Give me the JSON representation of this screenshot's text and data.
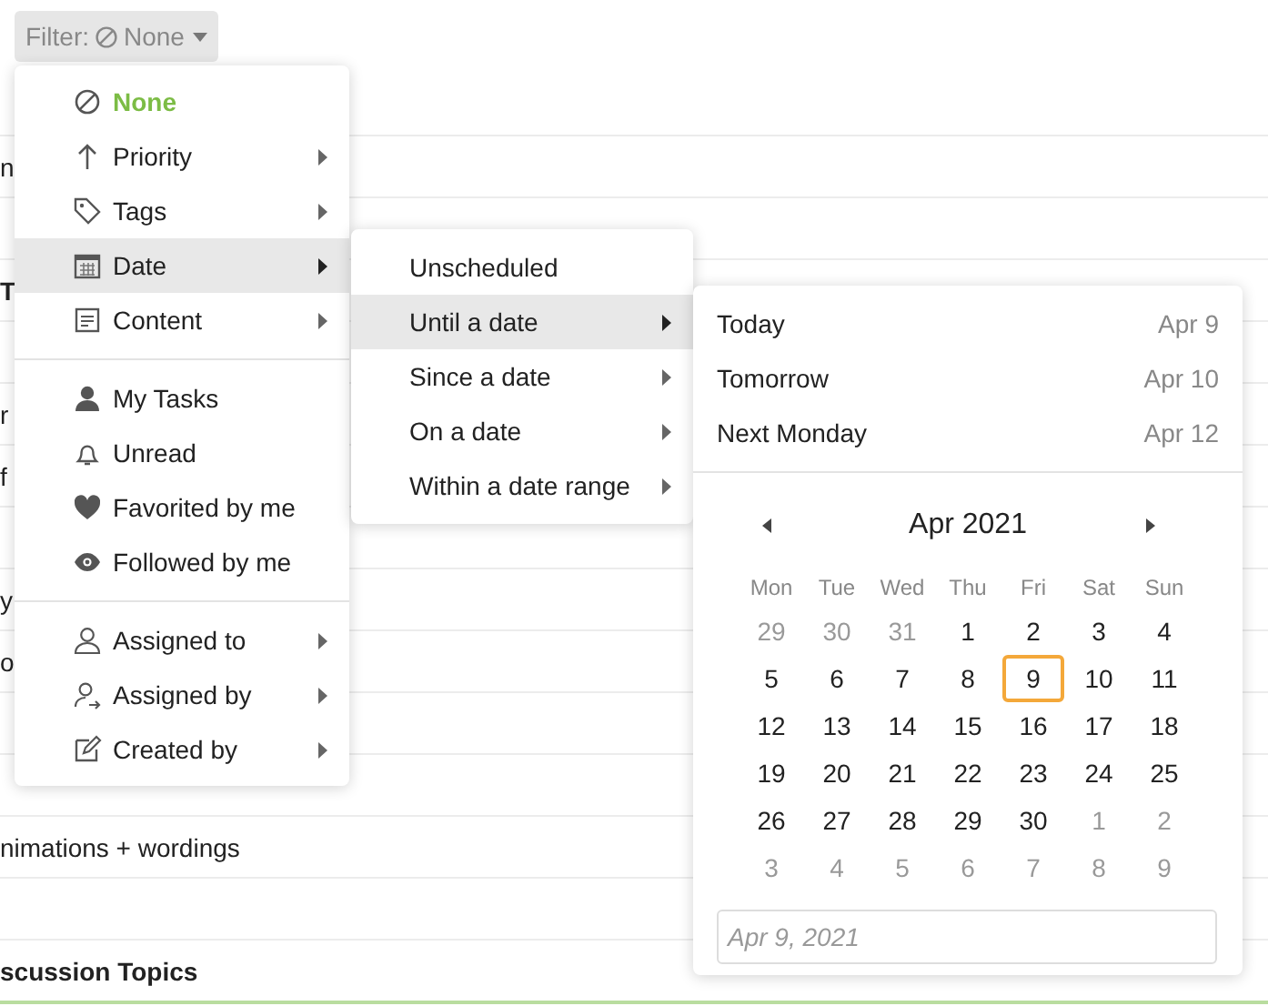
{
  "filter_button": {
    "label": "Filter:",
    "value": "None"
  },
  "background_rows": [
    {
      "kind": "blank"
    },
    {
      "kind": "text",
      "text": "n",
      "bold": false
    },
    {
      "kind": "blank"
    },
    {
      "kind": "text",
      "text": "T",
      "bold": true
    },
    {
      "kind": "blank"
    },
    {
      "kind": "text",
      "text": "r",
      "bold": false
    },
    {
      "kind": "text",
      "text": "f",
      "bold": false
    },
    {
      "kind": "blank"
    },
    {
      "kind": "text",
      "text": "y",
      "bold": false
    },
    {
      "kind": "text",
      "text": "o",
      "bold": false
    },
    {
      "kind": "blank"
    },
    {
      "kind": "blank"
    },
    {
      "kind": "text",
      "text": "nimations + wordings",
      "bold": false
    },
    {
      "kind": "blank"
    },
    {
      "kind": "text",
      "text": "scussion Topics",
      "bold": true
    }
  ],
  "filter_menu": {
    "groups": [
      [
        {
          "label": "None",
          "active": true,
          "submenu": false,
          "selected": false
        },
        {
          "label": "Priority",
          "active": false,
          "submenu": true,
          "selected": false
        },
        {
          "label": "Tags",
          "active": false,
          "submenu": true,
          "selected": false
        },
        {
          "label": "Date",
          "active": false,
          "submenu": true,
          "selected": true
        },
        {
          "label": "Content",
          "active": false,
          "submenu": true,
          "selected": false
        }
      ],
      [
        {
          "label": "My Tasks",
          "active": false,
          "submenu": false,
          "selected": false
        },
        {
          "label": "Unread",
          "active": false,
          "submenu": false,
          "selected": false
        },
        {
          "label": "Favorited by me",
          "active": false,
          "submenu": false,
          "selected": false
        },
        {
          "label": "Followed by me",
          "active": false,
          "submenu": false,
          "selected": false
        }
      ],
      [
        {
          "label": "Assigned to",
          "active": false,
          "submenu": true,
          "selected": false
        },
        {
          "label": "Assigned by",
          "active": false,
          "submenu": true,
          "selected": false
        },
        {
          "label": "Created by",
          "active": false,
          "submenu": true,
          "selected": false
        }
      ]
    ]
  },
  "date_menu": {
    "items": [
      {
        "label": "Unscheduled",
        "submenu": false,
        "selected": false
      },
      {
        "label": "Until a date",
        "submenu": true,
        "selected": true
      },
      {
        "label": "Since a date",
        "submenu": true,
        "selected": false
      },
      {
        "label": "On a date",
        "submenu": true,
        "selected": false
      },
      {
        "label": "Within a date range",
        "submenu": true,
        "selected": false
      }
    ]
  },
  "date_picker": {
    "shortcuts": [
      {
        "label": "Today",
        "date": "Apr 9"
      },
      {
        "label": "Tomorrow",
        "date": "Apr 10"
      },
      {
        "label": "Next Monday",
        "date": "Apr 12"
      }
    ],
    "month": "Apr 2021",
    "weekdays": [
      "Mon",
      "Tue",
      "Wed",
      "Thu",
      "Fri",
      "Sat",
      "Sun"
    ],
    "weeks": [
      [
        {
          "d": "29",
          "muted": true,
          "today": false
        },
        {
          "d": "30",
          "muted": true,
          "today": false
        },
        {
          "d": "31",
          "muted": true,
          "today": false
        },
        {
          "d": "1",
          "muted": false,
          "today": false
        },
        {
          "d": "2",
          "muted": false,
          "today": false
        },
        {
          "d": "3",
          "muted": false,
          "today": false
        },
        {
          "d": "4",
          "muted": false,
          "today": false
        }
      ],
      [
        {
          "d": "5",
          "muted": false,
          "today": false
        },
        {
          "d": "6",
          "muted": false,
          "today": false
        },
        {
          "d": "7",
          "muted": false,
          "today": false
        },
        {
          "d": "8",
          "muted": false,
          "today": false
        },
        {
          "d": "9",
          "muted": false,
          "today": true
        },
        {
          "d": "10",
          "muted": false,
          "today": false
        },
        {
          "d": "11",
          "muted": false,
          "today": false
        }
      ],
      [
        {
          "d": "12",
          "muted": false,
          "today": false
        },
        {
          "d": "13",
          "muted": false,
          "today": false
        },
        {
          "d": "14",
          "muted": false,
          "today": false
        },
        {
          "d": "15",
          "muted": false,
          "today": false
        },
        {
          "d": "16",
          "muted": false,
          "today": false
        },
        {
          "d": "17",
          "muted": false,
          "today": false
        },
        {
          "d": "18",
          "muted": false,
          "today": false
        }
      ],
      [
        {
          "d": "19",
          "muted": false,
          "today": false
        },
        {
          "d": "20",
          "muted": false,
          "today": false
        },
        {
          "d": "21",
          "muted": false,
          "today": false
        },
        {
          "d": "22",
          "muted": false,
          "today": false
        },
        {
          "d": "23",
          "muted": false,
          "today": false
        },
        {
          "d": "24",
          "muted": false,
          "today": false
        },
        {
          "d": "25",
          "muted": false,
          "today": false
        }
      ],
      [
        {
          "d": "26",
          "muted": false,
          "today": false
        },
        {
          "d": "27",
          "muted": false,
          "today": false
        },
        {
          "d": "28",
          "muted": false,
          "today": false
        },
        {
          "d": "29",
          "muted": false,
          "today": false
        },
        {
          "d": "30",
          "muted": false,
          "today": false
        },
        {
          "d": "1",
          "muted": true,
          "today": false
        },
        {
          "d": "2",
          "muted": true,
          "today": false
        }
      ],
      [
        {
          "d": "3",
          "muted": true,
          "today": false
        },
        {
          "d": "4",
          "muted": true,
          "today": false
        },
        {
          "d": "5",
          "muted": true,
          "today": false
        },
        {
          "d": "6",
          "muted": true,
          "today": false
        },
        {
          "d": "7",
          "muted": true,
          "today": false
        },
        {
          "d": "8",
          "muted": true,
          "today": false
        },
        {
          "d": "9",
          "muted": true,
          "today": false
        }
      ]
    ],
    "date_field": {
      "placeholder": "Apr 9, 2021"
    }
  }
}
